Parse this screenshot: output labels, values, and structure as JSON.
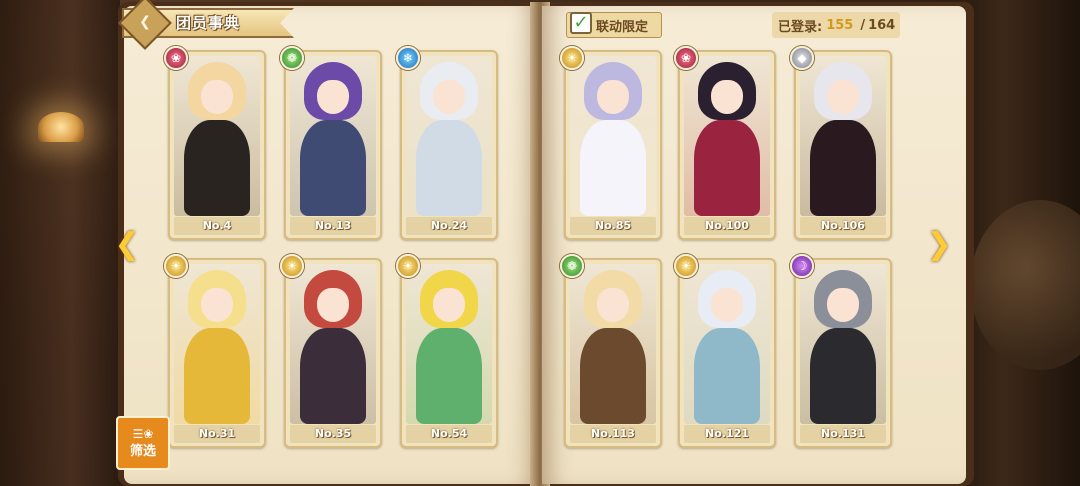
{
  "header": {
    "title": "团员事典",
    "collab_label": "联动限定",
    "login_label": "已登录:",
    "login_current": "155",
    "login_total": "164"
  },
  "filter": {
    "label": "筛选"
  },
  "left_page": [
    {
      "no": "No.4",
      "element": "fire",
      "hair": "#f3d6a0",
      "outfit": "#2a2420"
    },
    {
      "no": "No.13",
      "element": "wind",
      "hair": "#6c4aa8",
      "outfit": "#3f4b73"
    },
    {
      "no": "No.24",
      "element": "water",
      "hair": "#e9edf1",
      "outfit": "#d0dbe6"
    },
    {
      "no": "No.31",
      "element": "light",
      "hair": "#f6df8c",
      "outfit": "#e6b83a"
    },
    {
      "no": "No.35",
      "element": "light",
      "hair": "#c44a3f",
      "outfit": "#3b2d3a"
    },
    {
      "no": "No.54",
      "element": "light",
      "hair": "#f2d64a",
      "outfit": "#5fb06c"
    }
  ],
  "right_page": [
    {
      "no": "No.85",
      "element": "light",
      "hair": "#bdb8e0",
      "outfit": "#f4f4fa"
    },
    {
      "no": "No.100",
      "element": "fire",
      "hair": "#2a2030",
      "outfit": "#9a2340"
    },
    {
      "no": "No.106",
      "element": "metal",
      "hair": "#e6e6ec",
      "outfit": "#2a1a1f"
    },
    {
      "no": "No.113",
      "element": "wind",
      "hair": "#f2dba6",
      "outfit": "#6c4a2e"
    },
    {
      "no": "No.121",
      "element": "light",
      "hair": "#e8ecf5",
      "outfit": "#8fb8c9"
    },
    {
      "no": "No.131",
      "element": "dark",
      "hair": "#8a8f9a",
      "outfit": "#2b2a2f"
    }
  ],
  "colors": {
    "accent": "#ffcc33",
    "page": "#f6ecd6",
    "filter": "#e68a1e"
  }
}
